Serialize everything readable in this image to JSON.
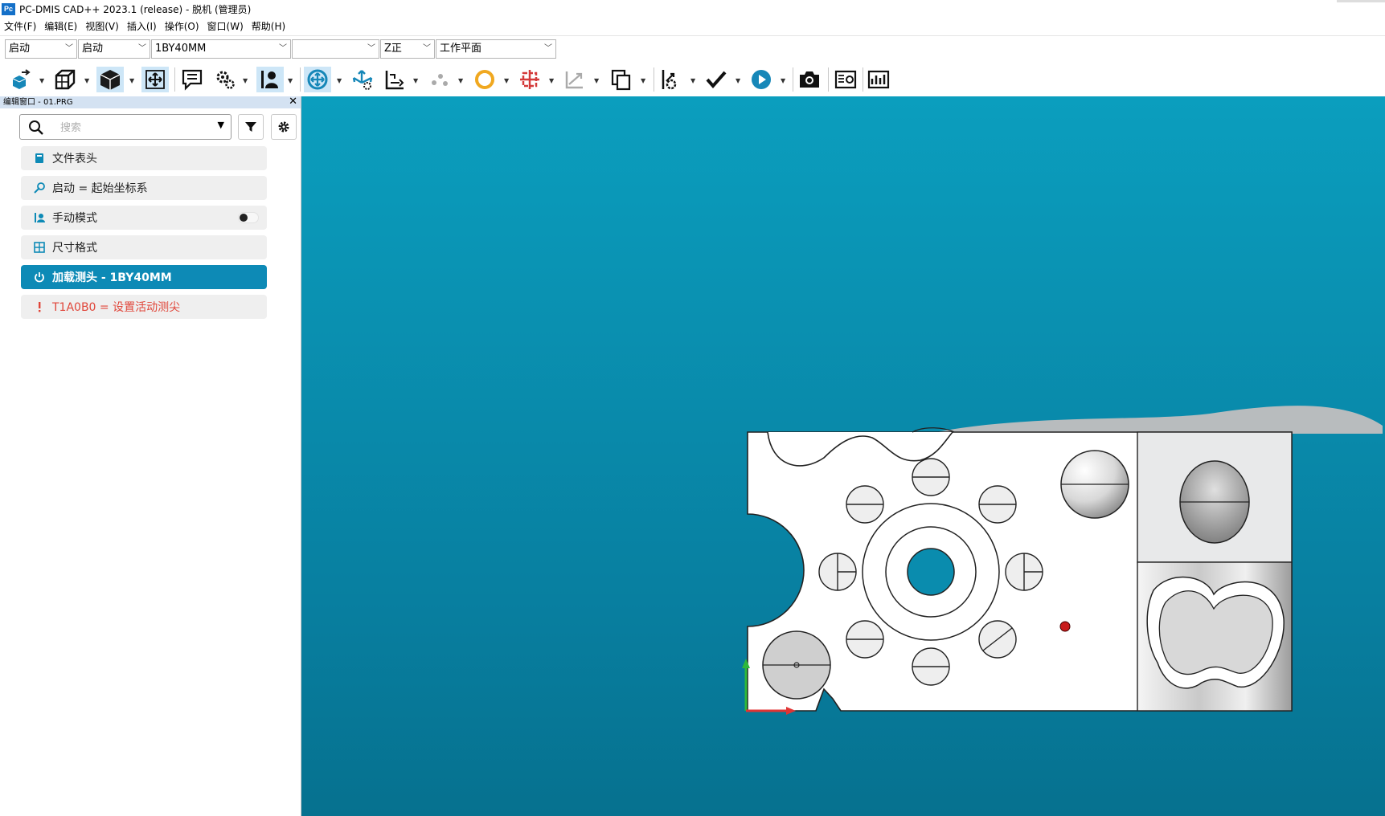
{
  "window": {
    "app_logo": "Pc",
    "title": "PC-DMIS CAD++ 2023.1 (release) - 脱机 (管理员)"
  },
  "menu": [
    "文件(F)",
    "编辑(E)",
    "视图(V)",
    "插入(I)",
    "操作(O)",
    "窗口(W)",
    "帮助(H)"
  ],
  "combos": [
    {
      "value": "启动"
    },
    {
      "value": "启动"
    },
    {
      "value": "1BY40MM"
    },
    {
      "value": ""
    },
    {
      "value": "Z正"
    },
    {
      "value": "工作平面"
    }
  ],
  "toolbar_icons": [
    "part-icon",
    "wireframe-cube-icon",
    "solid-cube-icon",
    "move-icon",
    "comment-icon",
    "gear-probe-icon",
    "manual-mode-icon",
    "rotate-icon",
    "translate-icon",
    "alignment-icon",
    "points-icon",
    "circle-feature-icon",
    "auto-feature-icon",
    "construct-icon",
    "copy-icon",
    "dimension-icon",
    "check-icon",
    "execute-icon",
    "camera-icon",
    "report-icon",
    "dashboard-icon"
  ],
  "edit_window": {
    "title": "编辑窗口 - 01.PRG",
    "search_placeholder": "搜索",
    "items": [
      {
        "label": "文件表头",
        "icon": "file-header-icon",
        "state": "normal"
      },
      {
        "label": "启动 = 起始坐标系",
        "icon": "alignment-icon",
        "state": "normal"
      },
      {
        "label": "手动模式",
        "icon": "manual-mode-icon",
        "state": "normal",
        "has_toggle": true
      },
      {
        "label": "尺寸格式",
        "icon": "dimension-format-icon",
        "state": "normal"
      },
      {
        "label": "加载测头 - 1BY40MM",
        "icon": "load-probe-icon",
        "state": "selected"
      },
      {
        "label": "T1A0B0 = 设置活动测尖",
        "icon": "warning-icon",
        "state": "error"
      }
    ]
  },
  "colors": {
    "accent": "#0d8ab6",
    "viewport_top": "#0b9ebe",
    "viewport_bottom": "#06718f",
    "error": "#e0463a"
  }
}
